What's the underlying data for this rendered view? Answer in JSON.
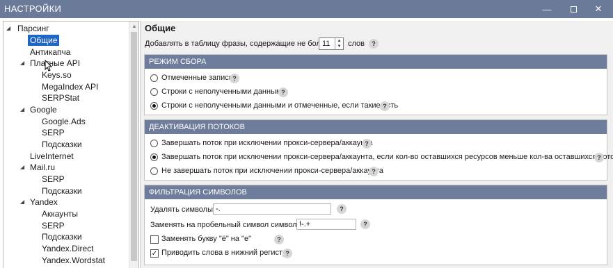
{
  "window": {
    "title": "НАСТРОЙКИ",
    "min_glyph": "—",
    "close_glyph": "✕"
  },
  "tree": {
    "items": [
      {
        "label": "Парсинг",
        "level": 0,
        "expanded": true
      },
      {
        "label": "Общие",
        "level": 1,
        "selected": true
      },
      {
        "label": "Антикапча",
        "level": 1
      },
      {
        "label": "Платные API",
        "level": 1,
        "expanded": true
      },
      {
        "label": "Keys.so",
        "level": 2
      },
      {
        "label": "MegaIndex API",
        "level": 2
      },
      {
        "label": "SERPStat",
        "level": 2
      },
      {
        "label": "Google",
        "level": 1,
        "expanded": true
      },
      {
        "label": "Google.Ads",
        "level": 2
      },
      {
        "label": "SERP",
        "level": 2
      },
      {
        "label": "Подсказки",
        "level": 2
      },
      {
        "label": "LiveInternet",
        "level": 1
      },
      {
        "label": "Mail.ru",
        "level": 1,
        "expanded": true
      },
      {
        "label": "SERP",
        "level": 2
      },
      {
        "label": "Подсказки",
        "level": 2
      },
      {
        "label": "Yandex",
        "level": 1,
        "expanded": true
      },
      {
        "label": "Аккаунты",
        "level": 2
      },
      {
        "label": "SERP",
        "level": 2
      },
      {
        "label": "Подсказки",
        "level": 2
      },
      {
        "label": "Yandex.Direct",
        "level": 2
      },
      {
        "label": "Yandex.Wordstat",
        "level": 2
      }
    ],
    "expanded_glyph": "◢"
  },
  "main": {
    "title": "Общие",
    "add_phrases": {
      "label": "Добавлять в таблицу фразы, содержащие не более",
      "value": "11",
      "unit": "слов"
    },
    "help_glyph": "?",
    "collect_mode": {
      "header": "РЕЖИМ СБОРА",
      "options": [
        {
          "label": "Отмеченные записи",
          "selected": false
        },
        {
          "label": "Строки с неполученными данными",
          "selected": false
        },
        {
          "label": "Строки с неполученными данными и отмеченные, если такие есть",
          "selected": true
        }
      ]
    },
    "thread_deactivation": {
      "header": "ДЕАКТИВАЦИЯ ПОТОКОВ",
      "options": [
        {
          "label": "Завершать поток при исключении прокси-сервера/аккаунта",
          "selected": false
        },
        {
          "label": "Завершать поток при исключении прокси-сервера/аккаунта, если кол-во оставшихся ресурсов меньше кол-ва оставшихся потоков",
          "selected": true
        },
        {
          "label": "Не завершать поток при исключении прокси-сервера/аккаунта",
          "selected": false
        }
      ]
    },
    "symbol_filter": {
      "header": "ФИЛЬТРАЦИЯ СИМВОЛОВ",
      "remove_label": "Удалять символы:",
      "remove_value": "-.",
      "replace_label": "Заменять на пробельный символ символы:",
      "replace_value": "!-.+",
      "yo_label": "Заменять букву \"ё\" на \"е\"",
      "yo_checked": false,
      "lower_label": "Приводить слова в нижний регистр",
      "lower_checked": true,
      "check_glyph": "✓"
    }
  }
}
